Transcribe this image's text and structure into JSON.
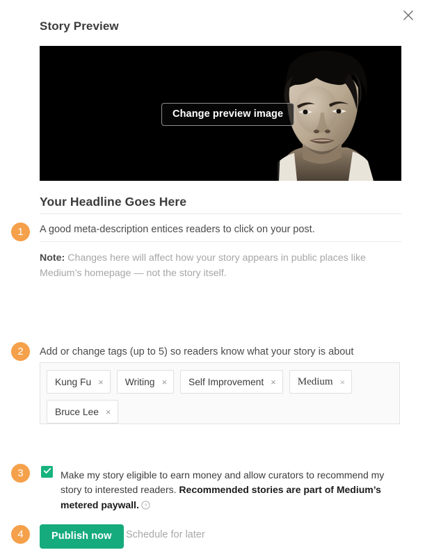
{
  "dialog": {
    "title": "Story Preview",
    "close_icon": "close-icon"
  },
  "preview": {
    "change_image_button": "Change preview image",
    "image_alt": "Bruce Lee portrait on black background"
  },
  "story": {
    "headline": "Your Headline Goes Here",
    "meta_description": "A good meta-description entices readers to click on your post.",
    "note_label": "Note:",
    "note_text": " Changes here will affect how your story appears in public places like Medium’s homepage — not the story itself."
  },
  "steps": {
    "one": "1",
    "two": "2",
    "three": "3",
    "four": "4"
  },
  "tags": {
    "label": "Add or change tags (up to 5) so readers know what your story is about",
    "remove_glyph": "×",
    "items": [
      {
        "label": "Kung Fu",
        "serif": false
      },
      {
        "label": "Writing",
        "serif": false
      },
      {
        "label": "Self Improvement",
        "serif": false
      },
      {
        "label": "Medium",
        "serif": true
      },
      {
        "label": "Bruce Lee",
        "serif": false
      }
    ]
  },
  "monetization": {
    "checked": true,
    "text_plain": "Make my story eligible to earn money and allow curators to recommend my story to interested readers. ",
    "text_bold": "Recommended stories are part of Medium’s metered paywall.",
    "help_icon": "help-circle-icon"
  },
  "footer": {
    "publish_label": "Publish now",
    "schedule_label": "Schedule for later"
  },
  "colors": {
    "accent_orange": "#f5a04a",
    "brand_green": "#16ab7d",
    "text_dark": "#3c3c3c",
    "text_muted": "#a6a6a6"
  }
}
